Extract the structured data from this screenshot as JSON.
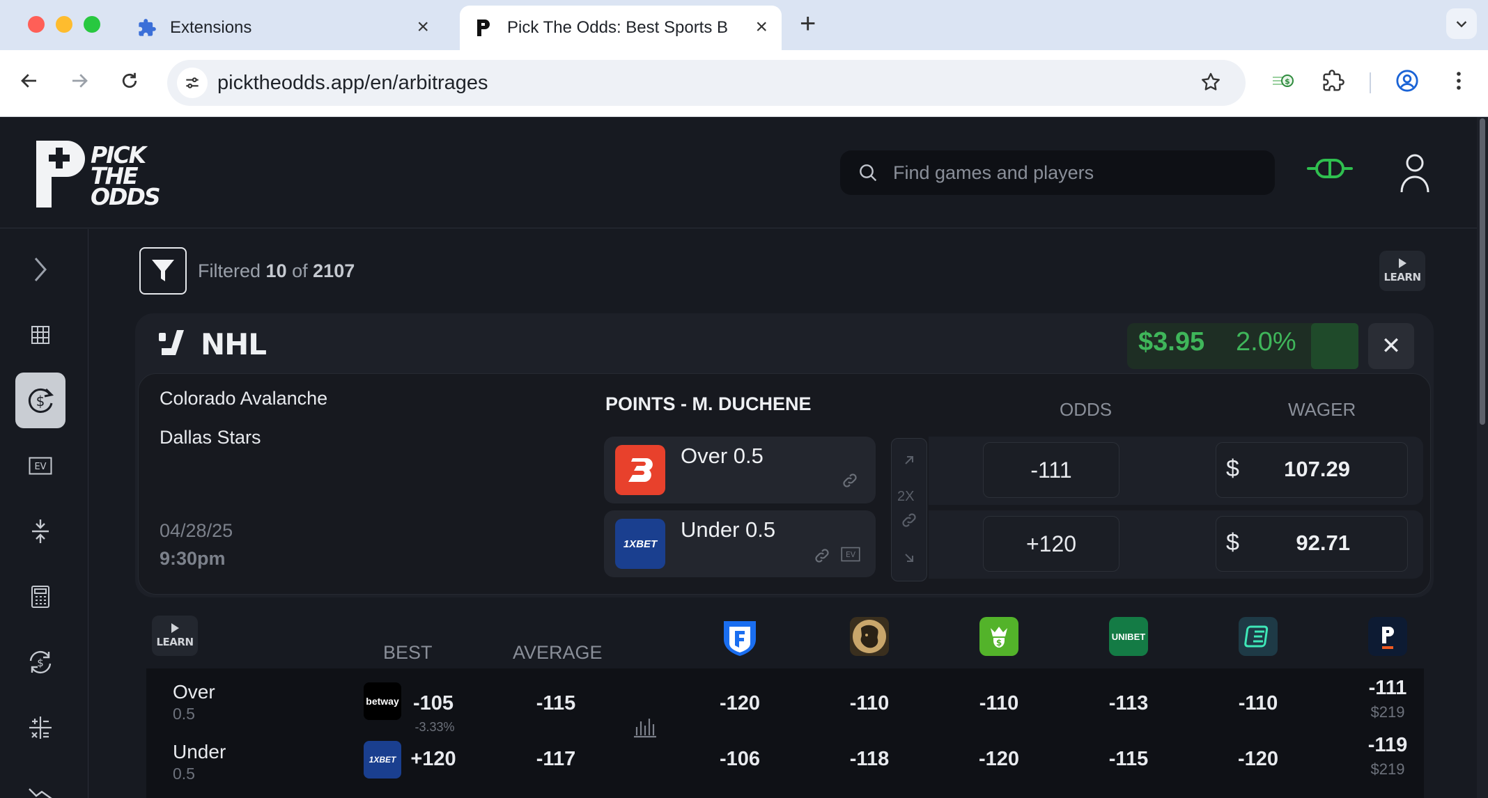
{
  "browser": {
    "tabs": [
      {
        "title": "Extensions",
        "active": false
      },
      {
        "title": "Pick The Odds: Best Sports B",
        "active": true
      }
    ],
    "url": "picktheodds.app/en/arbitrages"
  },
  "header": {
    "logo_lines": [
      "PICK",
      "THE",
      "ODDS"
    ],
    "search_placeholder": "Find games and players"
  },
  "filter": {
    "prefix": "Filtered",
    "shown": "10",
    "of": "of",
    "total": "2107"
  },
  "learn_label": "LEARN",
  "arb": {
    "league": "NHL",
    "profit": "$3.95",
    "percent": "2.0%",
    "close": "✕",
    "teams": [
      "Colorado Avalanche",
      "Dallas Stars"
    ],
    "date": "04/28/25",
    "time": "9:30pm",
    "market": "POINTS - M. DUCHENE",
    "col_odds": "ODDS",
    "col_wager": "WAGER",
    "multiplier": "2X",
    "currency": "$",
    "bets": [
      {
        "label": "Over 0.5",
        "book": "betrivers",
        "odds": "-111",
        "wager": "107.29"
      },
      {
        "label": "Under 0.5",
        "book": "1xbet",
        "odds": "+120",
        "wager": "92.71"
      }
    ]
  },
  "odds_table": {
    "col_best": "BEST",
    "col_average": "AVERAGE",
    "books": [
      "fanduel",
      "betmgm",
      "draftkings",
      "unibet",
      "espnbet",
      "pointsbet"
    ],
    "rows": [
      {
        "name": "Over",
        "line": "0.5",
        "best_book": "betway",
        "best": "-105",
        "best_note": "-3.33%",
        "average": "-115",
        "book_odds": [
          "-120",
          "-110",
          "-110",
          "-113",
          "-110",
          "-111"
        ],
        "last_stake": "$219"
      },
      {
        "name": "Under",
        "line": "0.5",
        "best_book": "1XBET",
        "best": "+120",
        "average": "-117",
        "book_odds": [
          "-106",
          "-118",
          "-120",
          "-115",
          "-120",
          "-119"
        ],
        "last_stake": "$219"
      }
    ]
  },
  "colors": {
    "accent_green": "#3fb65a",
    "background": "#171a21"
  }
}
